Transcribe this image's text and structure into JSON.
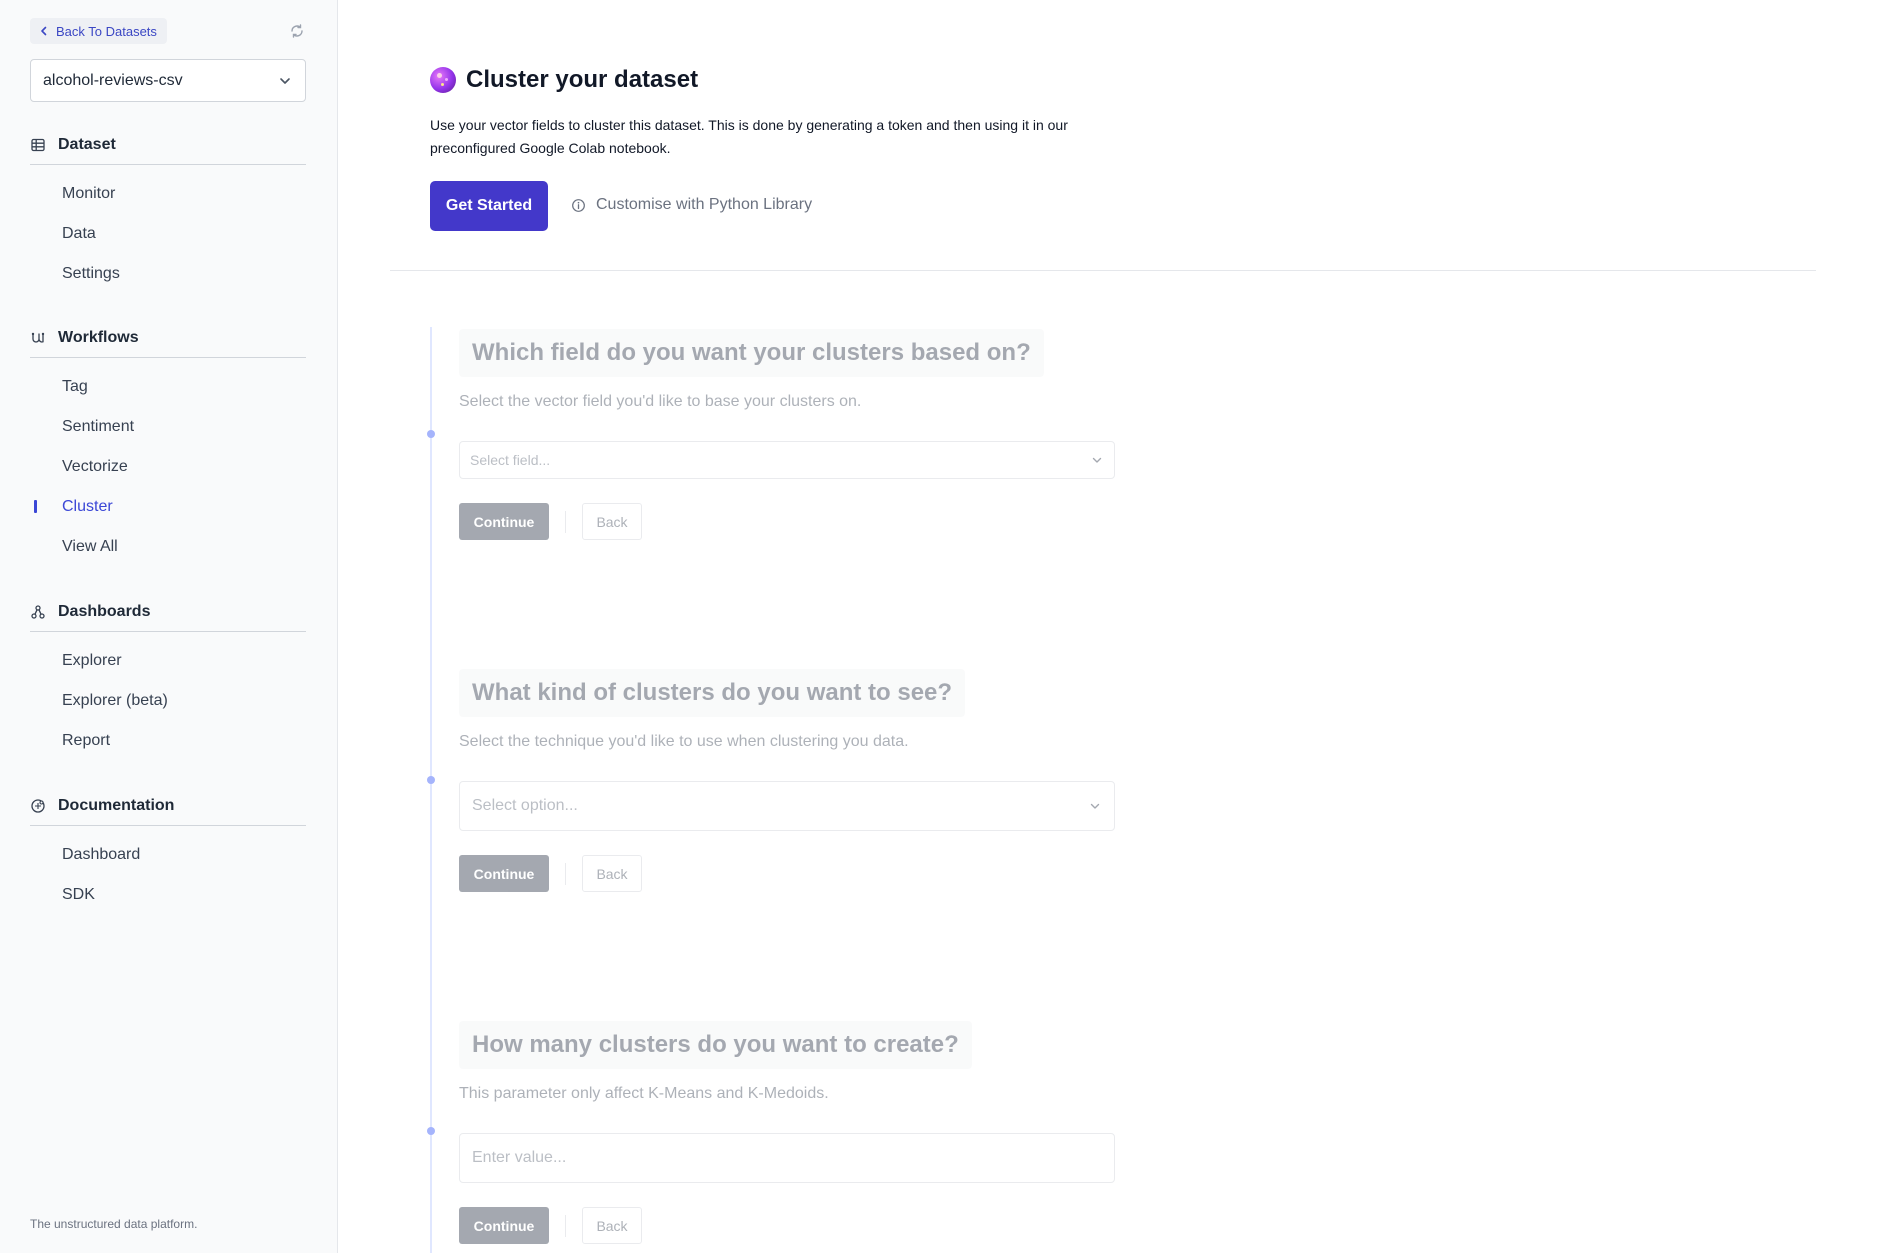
{
  "sidebar": {
    "back_label": "Back To Datasets",
    "dataset_selected": "alcohol-reviews-csv",
    "sections": [
      {
        "title": "Dataset",
        "icon": "table-icon",
        "items": [
          "Monitor",
          "Data",
          "Settings"
        ]
      },
      {
        "title": "Workflows",
        "icon": "workflow-icon",
        "items": [
          "Tag",
          "Sentiment",
          "Vectorize",
          "Cluster",
          "View All"
        ]
      },
      {
        "title": "Dashboards",
        "icon": "dashboard-icon",
        "items": [
          "Explorer",
          "Explorer (beta)",
          "Report"
        ]
      },
      {
        "title": "Documentation",
        "icon": "documentation-icon",
        "items": [
          "Dashboard",
          "SDK"
        ]
      }
    ],
    "active_item": "Cluster",
    "footer": "The unstructured data platform."
  },
  "main": {
    "title": "Cluster your dataset",
    "description": "Use your vector fields to cluster this dataset. This is done by generating a token and then using it in our preconfigured Google Colab notebook.",
    "get_started_label": "Get Started",
    "customise_label": "Customise with Python Library",
    "steps": [
      {
        "question": "Which field do you want your clusters based on?",
        "description": "Select the vector field you'd like to base your clusters on.",
        "placeholder": "Select field...",
        "continue_label": "Continue",
        "back_label": "Back"
      },
      {
        "question": "What kind of clusters do you want to see?",
        "description": "Select the technique you'd like to use when clustering you data.",
        "placeholder": "Select option...",
        "continue_label": "Continue",
        "back_label": "Back"
      },
      {
        "question": "How many clusters do you want to create?",
        "description": "This parameter only affect K-Means and K-Medoids.",
        "placeholder": "Enter value...",
        "continue_label": "Continue",
        "back_label": "Back"
      }
    ]
  },
  "colors": {
    "accent": "#4338ca",
    "active_nav": "#3b47d6",
    "timeline": "#e0e7ff"
  }
}
